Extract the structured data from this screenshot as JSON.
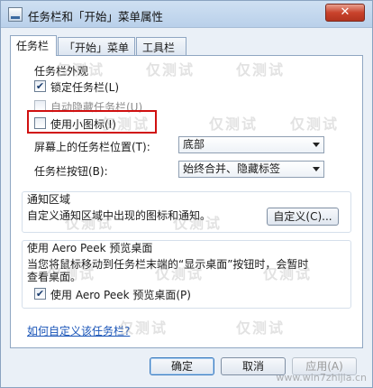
{
  "window": {
    "title": "任务栏和「开始」菜单属性",
    "close_label": "✕"
  },
  "tabs": [
    {
      "label": "任务栏",
      "active": true
    },
    {
      "label": "「开始」菜单",
      "active": false
    },
    {
      "label": "工具栏",
      "active": false
    }
  ],
  "appearance": {
    "group_label": "任务栏外观",
    "options": [
      {
        "label": "锁定任务栏(L)",
        "checked": true,
        "enabled": true
      },
      {
        "label": "自动隐藏任务栏(U)",
        "checked": false,
        "enabled": false
      },
      {
        "label": "使用小图标(I)",
        "checked": false,
        "enabled": true
      }
    ],
    "location_label": "屏幕上的任务栏位置(T):",
    "location_value": "底部",
    "buttons_label": "任务栏按钮(B):",
    "buttons_value": "始终合并、隐藏标签"
  },
  "notification": {
    "group_label": "通知区域",
    "description": "自定义通知区域中出现的图标和通知。",
    "customize_button": "自定义(C)..."
  },
  "aero_peek": {
    "group_label": "使用 Aero Peek 预览桌面",
    "description_line1": "当您将鼠标移动到任务栏末端的“显示桌面”按钮时，会暂时",
    "description_line2": "查看桌面。",
    "checkbox_label": "使用 Aero Peek 预览桌面(P)",
    "checked": true
  },
  "help_link": "如何自定义该任务栏?",
  "dialog_buttons": {
    "ok": "确定",
    "cancel": "取消",
    "apply": "应用(A)"
  },
  "watermark": {
    "text": "仅测试",
    "footer": "www.win7zhijia.cn"
  },
  "colors": {
    "highlight_border": "#d01010",
    "link": "#1a55b8"
  }
}
